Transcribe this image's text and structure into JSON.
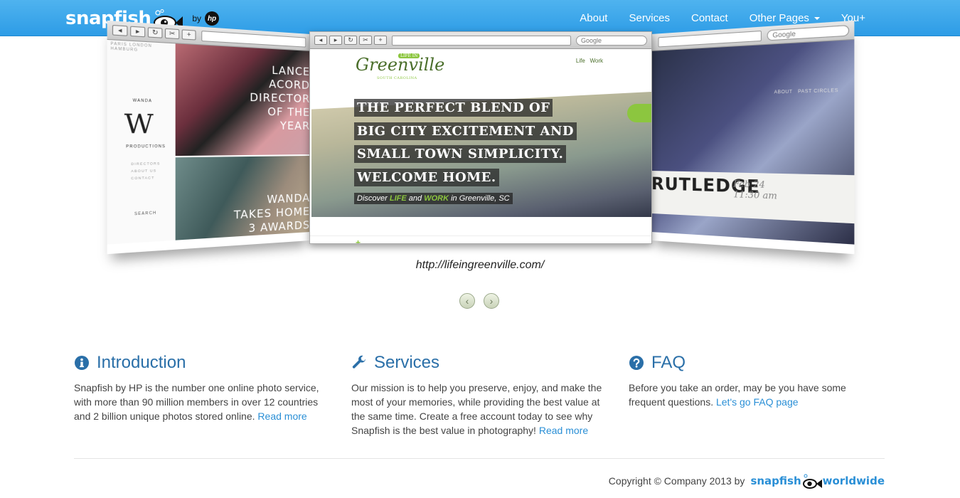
{
  "brand": {
    "name": "snapfish",
    "by": "by",
    "hp": "hp"
  },
  "nav": {
    "items": [
      {
        "label": "About"
      },
      {
        "label": "Services"
      },
      {
        "label": "Contact"
      },
      {
        "label": "Other Pages"
      },
      {
        "label": "You+"
      }
    ]
  },
  "carousel": {
    "caption": "http://lifeingreenville.com/",
    "browser": {
      "google_placeholder": "Google"
    },
    "left_slide": {
      "logo": "W",
      "logo_name": "WANDA",
      "logo_sub": "PRODUCTIONS",
      "photo_text_top": "LANCE ACORD DIRECTOR OF THE YEAR",
      "photo_text_bottom": "WANDA TAKES HOME 3 AWARDS",
      "side_links": [
        "DIRECTORS",
        "ABOUT US",
        "CONTACT"
      ],
      "top_links": [
        "PARIS",
        "LONDON",
        "HAMBURG"
      ],
      "search": "SEARCH"
    },
    "center_slide": {
      "logo_line1": "LIFE IN",
      "logo_line2": "Greenville",
      "logo_line3": "SOUTH CAROLINA",
      "nav_links": [
        "Life",
        "Work"
      ],
      "headline": [
        "THE PERFECT BLEND OF",
        "BIG CITY EXCITEMENT AND",
        "SMALL TOWN SIMPLICITY.",
        "WELCOME HOME."
      ],
      "sub_pre": "Discover",
      "sub_life": "LIFE",
      "sub_and": "and",
      "sub_work": "WORK",
      "sub_post": "in Greenville, SC",
      "plus": "+"
    },
    "right_slide": {
      "nav": [
        "ABOUT",
        "PAST CIRCLES"
      ],
      "title": "RUTLEDGE",
      "date": "Feb 24",
      "time": "11:30 am"
    },
    "prev_label": "‹",
    "next_label": "›"
  },
  "features": [
    {
      "icon": "info-circle-icon",
      "title": "Introduction",
      "text": "Snapfish by HP is the number one online photo service, with more than 90 million members in over 12 countries and 2 billion unique photos stored online.",
      "link": "Read more"
    },
    {
      "icon": "wrench-icon",
      "title": "Services",
      "text": "Our mission is to help you preserve, enjoy, and make the most of your memories, while providing the best value at the same time. Create a free account today to see why Snapfish is the best value in photography!",
      "link": "Read more"
    },
    {
      "icon": "question-circle-icon",
      "title": "FAQ",
      "text": "Before you take an order, may be you have some frequent questions.",
      "link": "Let's go FAQ page"
    }
  ],
  "footer": {
    "copyright": "Copyright © Company 2013 by",
    "brand": "snapfish",
    "worldwide": "worldwide"
  },
  "colors": {
    "navbar": "#2d9ce6",
    "link": "#2a8fd6",
    "heading": "#2a6fa8",
    "accent_green": "#8cc63f"
  }
}
